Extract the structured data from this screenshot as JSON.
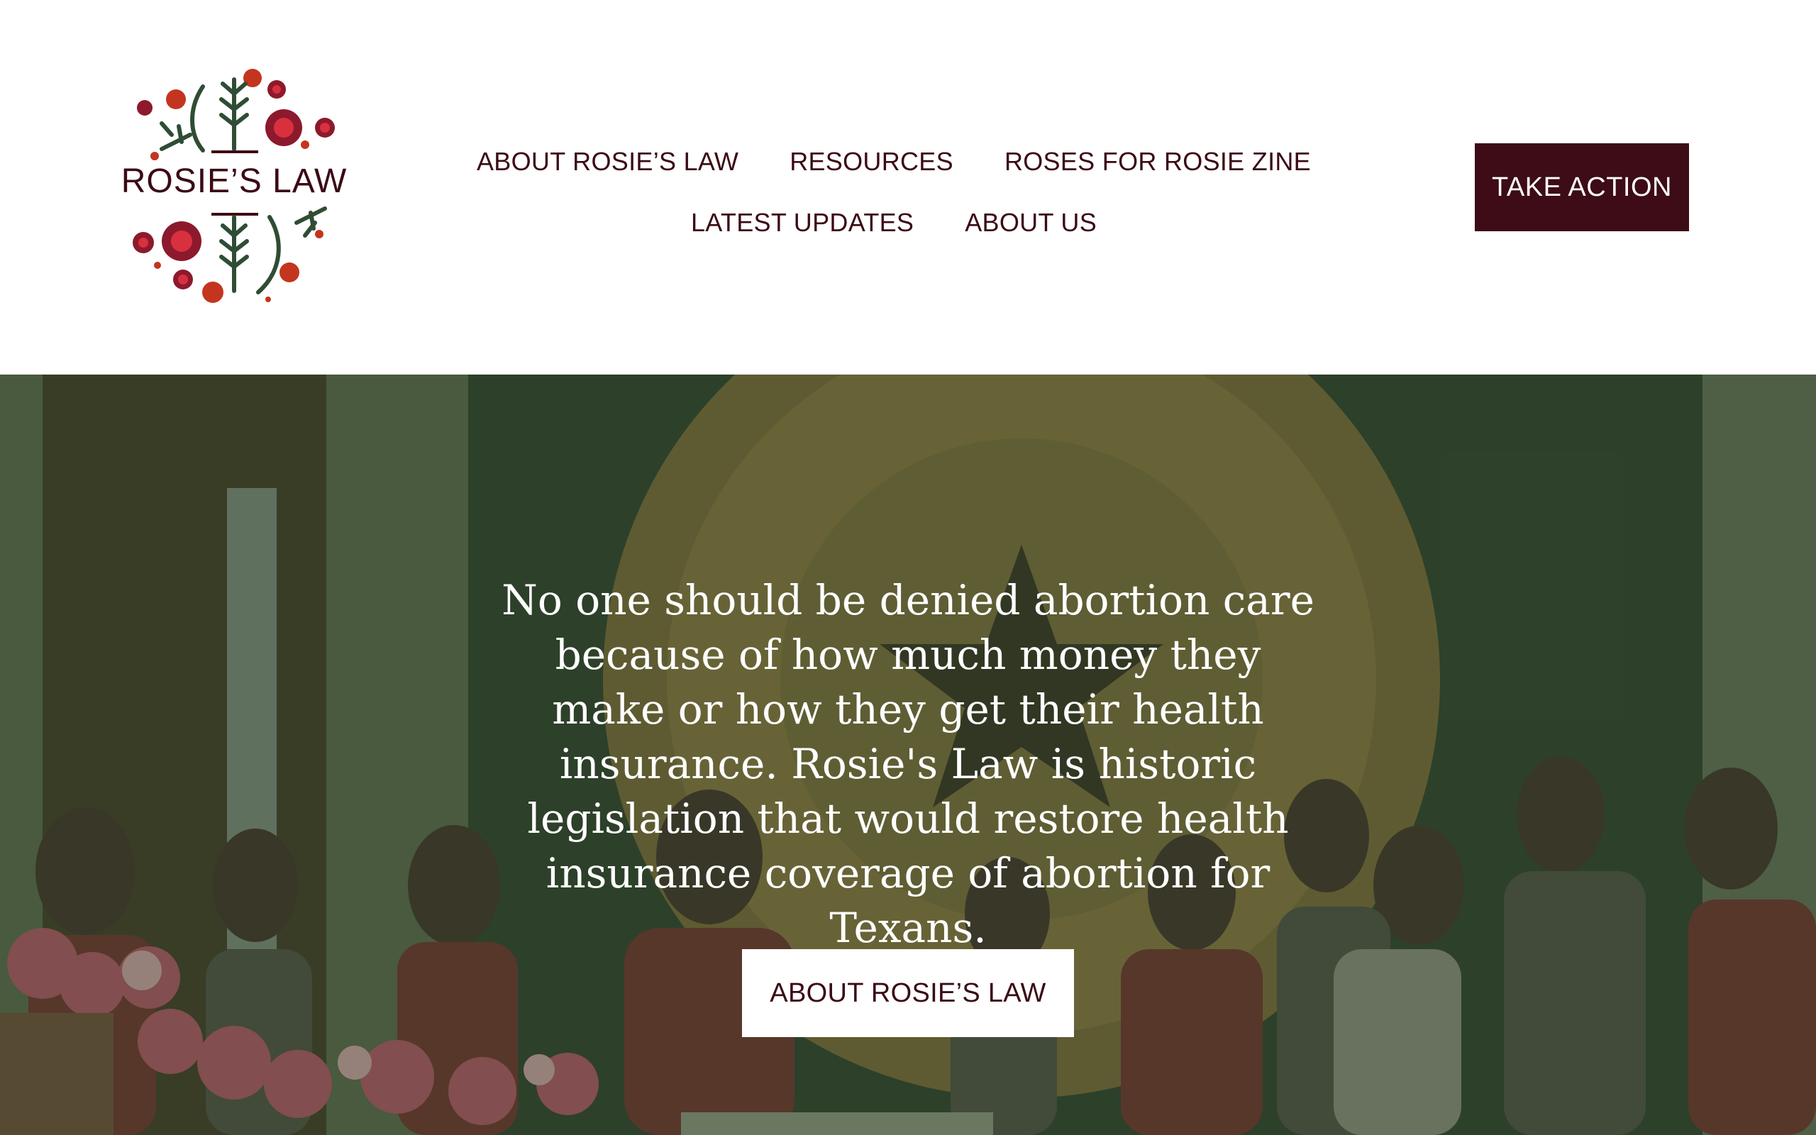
{
  "brand": {
    "logo_text": "ROSIE’S LAW",
    "primary_color": "#3d0c16",
    "accent_color": "#c4351f"
  },
  "nav": {
    "row1": [
      "ABOUT ROSIE’S LAW",
      "RESOURCES",
      "ROSES FOR ROSIE ZINE"
    ],
    "row2": [
      "LATEST UPDATES",
      "ABOUT US"
    ]
  },
  "header_cta": "TAKE ACTION",
  "hero": {
    "text": "No one should be denied abortion care because of how much money they make or how they get their health insurance. Rosie's Law is historic legislation that would restore health insurance coverage of abortion for Texans.",
    "button": "ABOUT ROSIE’S LAW"
  }
}
